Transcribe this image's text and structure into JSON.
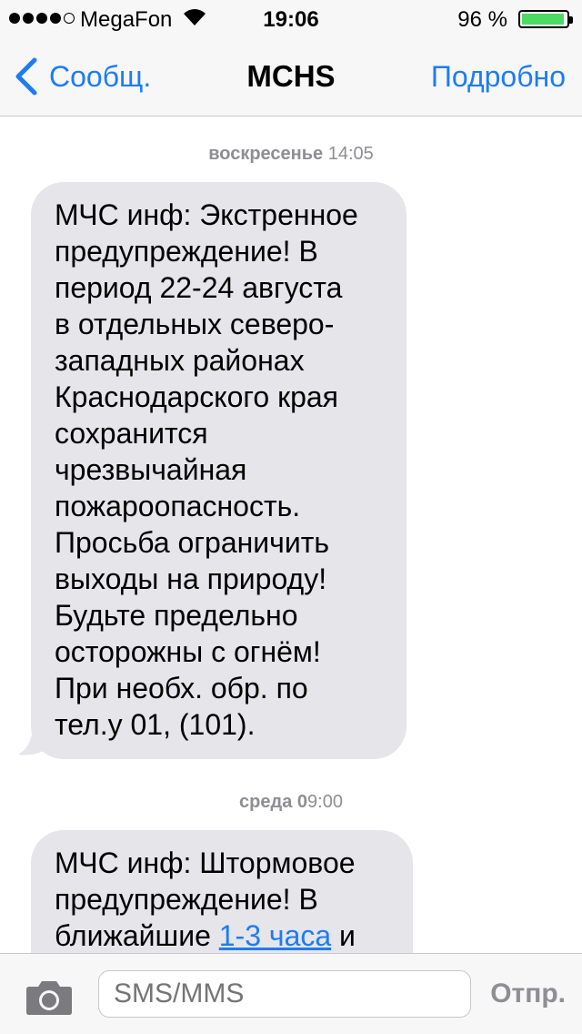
{
  "status_bar": {
    "carrier": "MegaFon",
    "time": "19:06",
    "battery_percent": "96 %",
    "battery_level": 0.96,
    "signal_bars": 4,
    "signal_max": 5
  },
  "nav": {
    "back_label": "Сообщ.",
    "title": "MCHS",
    "details_label": "Подробно"
  },
  "messages": [
    {
      "day": "воскресенье",
      "time": "14:05",
      "lines": [
        "МЧС инф: Экстренное",
        "предупреждение! В",
        "период 22-24 августа",
        "в отдельных северо-",
        "западных районах",
        "Краснодарского края",
        "сохранится",
        "чрезвычайная",
        "пожароопасность.",
        "Просьба ограничить",
        "выходы на природу!",
        "Будьте предельно",
        "осторожны с огнём!",
        "При необх. обр. по",
        "тел.у 01, (101)."
      ]
    },
    {
      "day": "среда 0",
      "time": "9:00",
      "line1": "МЧС инф: Штормовое",
      "line2": "предупреждение! В",
      "line3_before": "ближайшие ",
      "line3_link": "1-3 часа",
      "line3_after": " и"
    }
  ],
  "composer": {
    "placeholder": "SMS/MMS",
    "send_label": "Отпр."
  },
  "colors": {
    "accent": "#1d7cf5",
    "bubble": "#e5e5ea",
    "battery": "#4cd964",
    "timestamp": "#8e8e93"
  },
  "icons": [
    "wifi-icon",
    "battery-icon",
    "chevron-left-icon",
    "camera-icon"
  ]
}
